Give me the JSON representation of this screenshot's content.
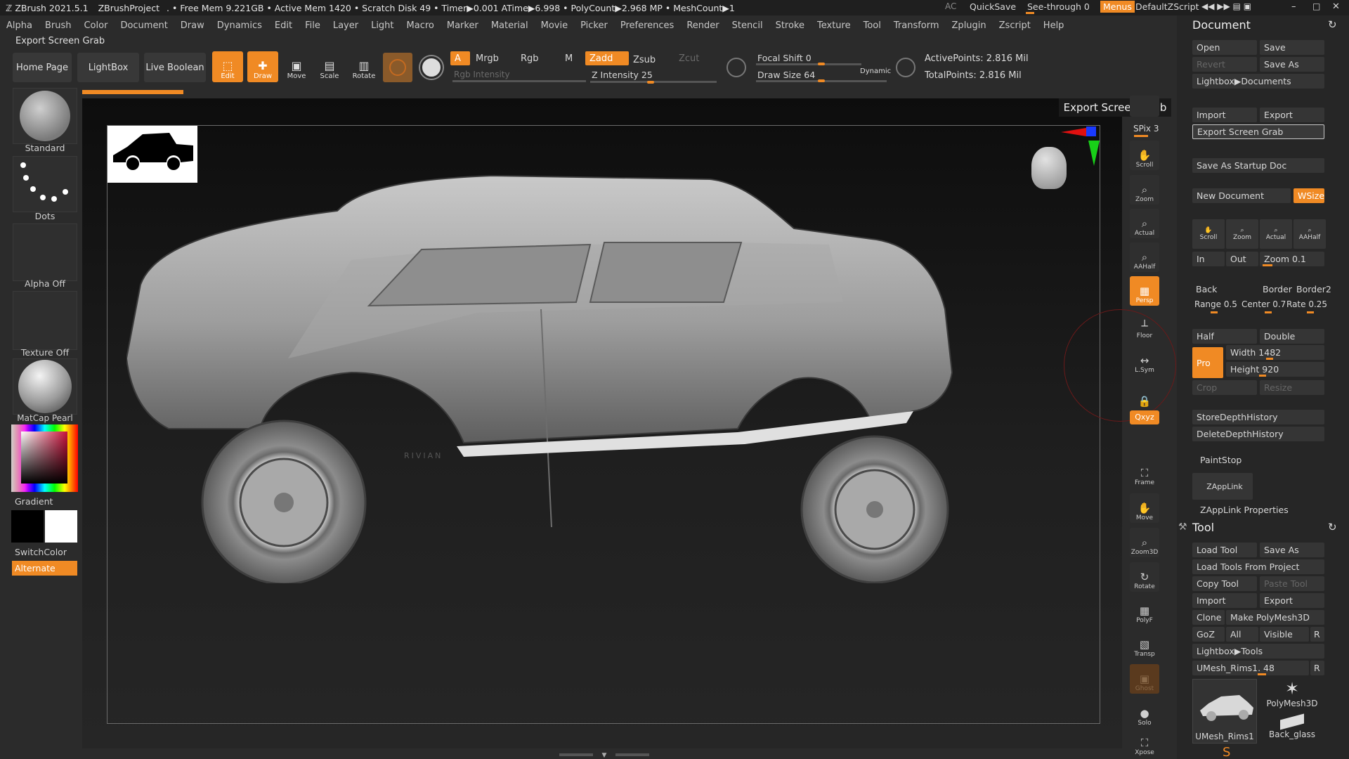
{
  "titlebar": {
    "app": "ZBrush 2021.5.1",
    "project": "ZBrushProject",
    "stats": ". • Free Mem 9.221GB • Active Mem 1420 • Scratch Disk 49 •  Timer▶0.001 ATime▶6.998 • PolyCount▶2.968 MP  • MeshCount▶1",
    "ac": "AC",
    "quicksave": "QuickSave",
    "seethrough": "See-through  0",
    "menus": "Menus",
    "script": "DefaultZScript"
  },
  "menubar": {
    "items": [
      "Alpha",
      "Brush",
      "Color",
      "Document",
      "Draw",
      "Dynamics",
      "Edit",
      "File",
      "Layer",
      "Light",
      "Macro",
      "Marker",
      "Material",
      "Movie",
      "Picker",
      "Preferences",
      "Render",
      "Stencil",
      "Stroke",
      "Texture",
      "Tool",
      "Transform",
      "Zplugin",
      "Zscript",
      "Help"
    ]
  },
  "subtitle": "Export Screen Grab",
  "shelf": {
    "home": "Home Page",
    "lightbox": "LightBox",
    "liveboolean": "Live Boolean",
    "edit": "Edit",
    "draw": "Draw",
    "move": "Move",
    "scale": "Scale",
    "rotate": "Rotate",
    "a": "A",
    "mrgb": "Mrgb",
    "rgb": "Rgb",
    "m": "M",
    "zadd": "Zadd",
    "zsub": "Zsub",
    "zcut": "Zcut",
    "rgb_intensity": "Rgb Intensity",
    "z_intensity": "Z Intensity 25",
    "focal_shift": "Focal Shift 0",
    "draw_size": "Draw Size 64",
    "dynamic": "Dynamic",
    "active_points": "ActivePoints: 2.816 Mil",
    "total_points": "TotalPoints: 2.816 Mil"
  },
  "left_tray": {
    "brush": "Standard",
    "stroke": "Dots",
    "alpha": "Alpha Off",
    "texture": "Texture Off",
    "material": "MatCap Pearl Ca",
    "gradient": "Gradient",
    "switchcolor": "SwitchColor",
    "alternate": "Alternate"
  },
  "viewport": {
    "badge": "RIVIAN",
    "tooltip": "Export Screen Grab"
  },
  "right_shelf": {
    "spix": "SPix 3",
    "items": [
      "Scroll",
      "Zoom",
      "Actual",
      "AAHalf",
      "Persp",
      "Floor",
      "L.Sym",
      "",
      "Qxyz",
      "Frame",
      "Move",
      "Zoom3D",
      "Rotate",
      "PolyF",
      "Transp",
      "Ghost",
      "Solo",
      "Xpose"
    ]
  },
  "document_panel": {
    "title": "Document",
    "open": "Open",
    "save": "Save",
    "revert": "Revert",
    "save_as": "Save As",
    "lightbox_docs": "Lightbox▶Documents",
    "import": "Import",
    "export": "Export",
    "export_grab": "Export Screen Grab",
    "save_startup": "Save As Startup Doc",
    "new_doc": "New Document",
    "wsize": "WSize",
    "scroll": "Scroll",
    "zoom": "Zoom",
    "actual": "Actual",
    "aahalf": "AAHalf",
    "in": "In",
    "out": "Out",
    "zoom_val": "Zoom 0.1",
    "back": "Back",
    "border": "Border",
    "border2": "Border2",
    "range": "Range 0.5",
    "center": "Center 0.7",
    "rate": "Rate 0.25",
    "half": "Half",
    "double": "Double",
    "pro": "Pro",
    "width": "Width 1482",
    "height": "Height 920",
    "crop": "Crop",
    "resize": "Resize",
    "store_depth": "StoreDepthHistory",
    "delete_depth": "DeleteDepthHistory",
    "paintstop": "PaintStop",
    "zapplink": "ZAppLink",
    "zapplink_props": "ZAppLink Properties"
  },
  "tool_panel": {
    "title": "Tool",
    "load_tool": "Load Tool",
    "save_as": "Save As",
    "load_from_project": "Load Tools From Project",
    "copy_tool": "Copy Tool",
    "paste_tool": "Paste Tool",
    "import": "Import",
    "export": "Export",
    "clone": "Clone",
    "make_polymesh": "Make PolyMesh3D",
    "goz": "GoZ",
    "all": "All",
    "visible": "Visible",
    "r": "R",
    "lightbox_tools": "Lightbox▶Tools",
    "umesh_slider": "UMesh_Rims1. 48",
    "thumb1": "UMesh_Rims1",
    "thumb2": "PolyMesh3D",
    "thumb3": "Back_glass"
  },
  "colors": {
    "accent": "#f08a24",
    "panel": "#262626",
    "button": "#353535"
  }
}
